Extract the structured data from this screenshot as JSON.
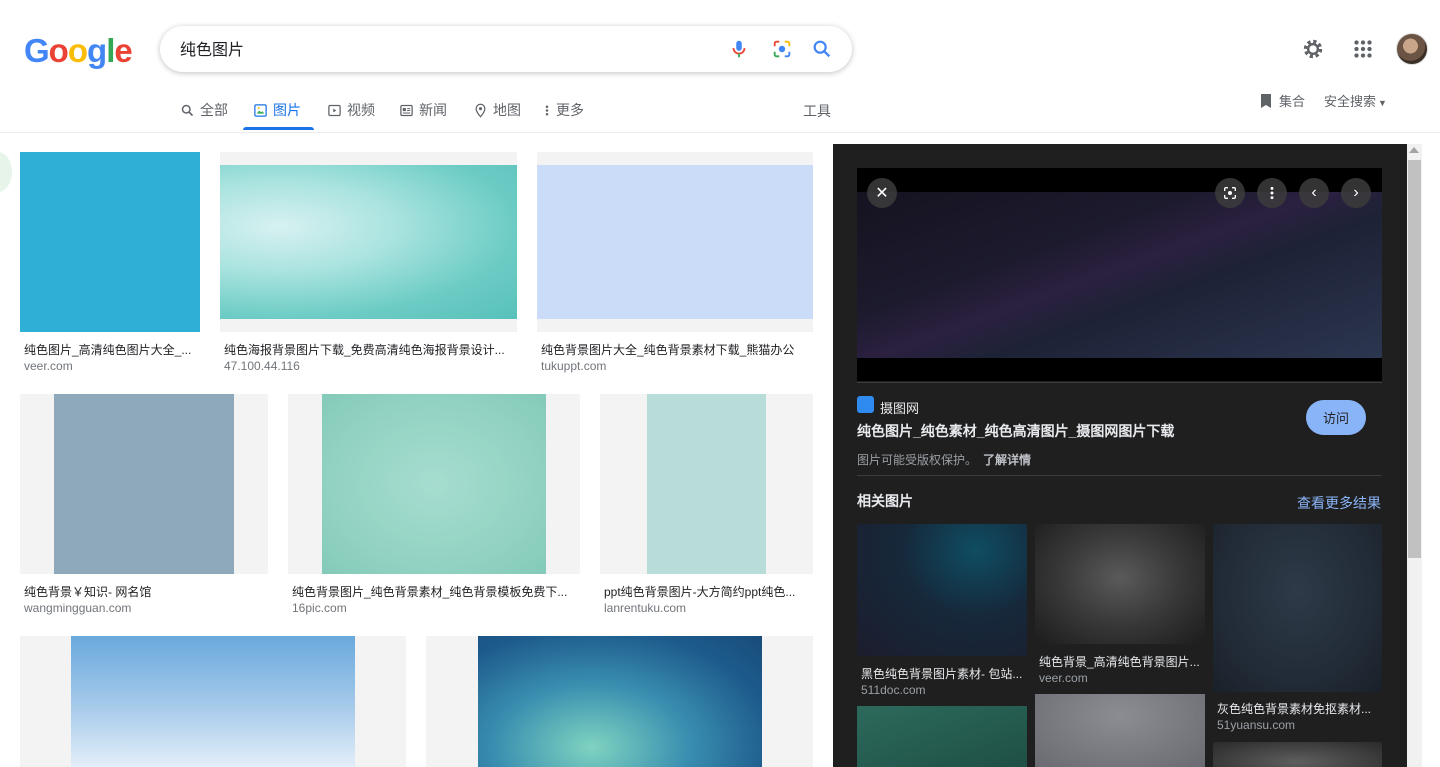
{
  "logo": {
    "letters": [
      "G",
      "o",
      "o",
      "g",
      "l",
      "e"
    ],
    "colors": [
      "#4285f4",
      "#ea4335",
      "#fbbc05",
      "#4285f4",
      "#34a853",
      "#ea4335"
    ]
  },
  "search": {
    "query": "纯色图片",
    "icons": [
      "mic-icon",
      "lens-icon",
      "search-icon"
    ]
  },
  "header_icons": [
    "settings-icon",
    "apps-grid-icon",
    "account-avatar"
  ],
  "tabs": [
    {
      "label": "全部",
      "icon": "search-icon"
    },
    {
      "label": "图片",
      "icon": "image-icon",
      "active": true
    },
    {
      "label": "视频",
      "icon": "video-icon"
    },
    {
      "label": "新闻",
      "icon": "news-icon"
    },
    {
      "label": "地图",
      "icon": "map-pin-icon"
    },
    {
      "label": "更多",
      "icon": "more-vert-icon"
    }
  ],
  "tools_label": "工具",
  "collections_label": "集合",
  "safe_search_label": "安全搜索",
  "results": [
    {
      "caption": "纯色图片_高清纯色图片大全_...",
      "domain": "veer.com",
      "color": "#2eb0d6"
    },
    {
      "caption": "纯色海报背景图片下载_免费高清纯色海报背景设计...",
      "domain": "47.100.44.116",
      "color": "#7fd6d0"
    },
    {
      "caption": "纯色背景图片大全_纯色背景素材下载_熊猫办公",
      "domain": "tukuppt.com",
      "color": "#cadcf7"
    },
    {
      "caption": "纯色背景￥知识- 网名馆",
      "domain": "wangmingguan.com",
      "color": "#8ea9bc"
    },
    {
      "caption": "纯色背景图片_纯色背景素材_纯色背景模板免费下...",
      "domain": "16pic.com",
      "color": "#93d3c3"
    },
    {
      "caption": "ppt纯色背景图片-大方简约ppt纯色...",
      "domain": "lanrentuku.com",
      "color": "#b8dcd8"
    },
    {
      "caption": "",
      "domain": "",
      "color": "#86b7e0"
    },
    {
      "caption": "",
      "domain": "",
      "color": "#2a6c98"
    }
  ],
  "panel": {
    "site_name": "摄图网",
    "title": "纯色图片_纯色素材_纯色高清图片_摄图网图片下载",
    "visit_label": "访问",
    "copyright_note": "图片可能受版权保护。",
    "learn_more": "了解详情",
    "related_title": "相关图片",
    "see_more": "查看更多结果",
    "buttons": [
      "close-icon",
      "lens-icon",
      "more-vert-icon",
      "chevron-left-icon",
      "chevron-right-icon"
    ],
    "related": [
      {
        "caption": "黑色纯色背景图片素材- 包站...",
        "domain": "511doc.com"
      },
      {
        "caption": "纯色背景_高清纯色背景图片...",
        "domain": "veer.com"
      },
      {
        "caption": "灰色纯色背景素材免抠素材...",
        "domain": "51yuansu.com"
      }
    ]
  }
}
